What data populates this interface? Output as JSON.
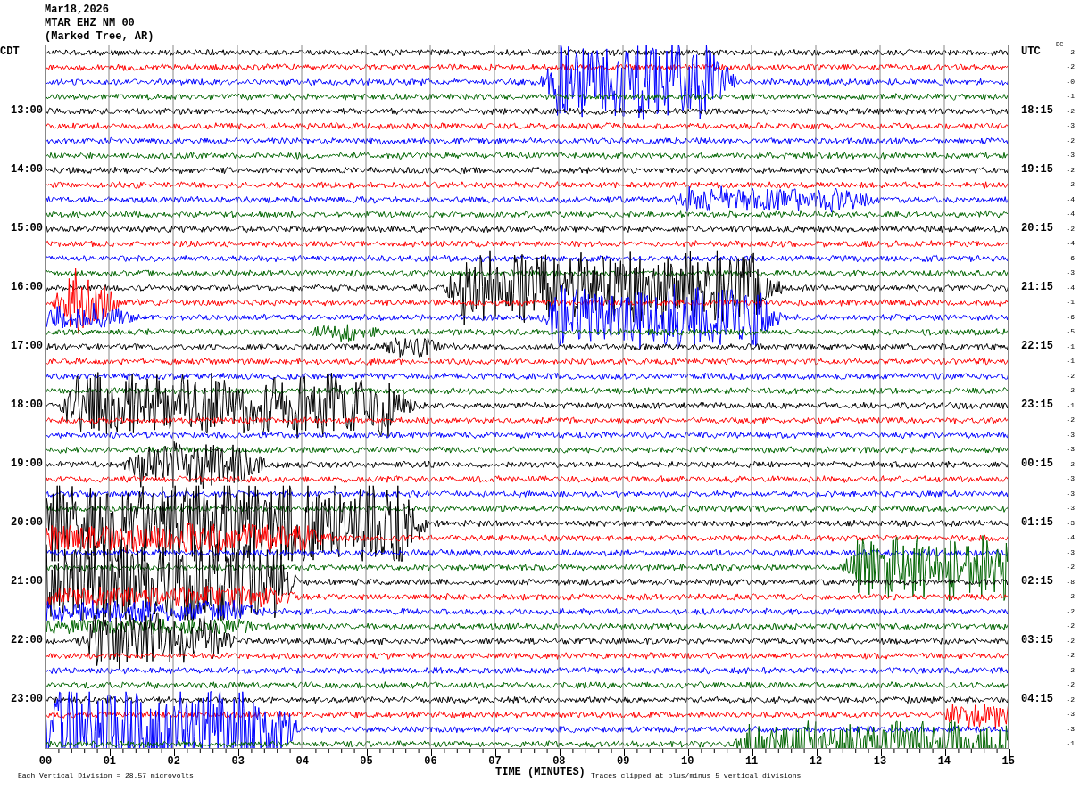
{
  "header": {
    "date": "Mar18,2026",
    "station": "MTAR EHZ NM 00",
    "location": "(Marked Tree, AR)"
  },
  "left_axis": {
    "title": "CDT",
    "hours": [
      "13:00",
      "14:00",
      "15:00",
      "16:00",
      "17:00",
      "18:00",
      "19:00",
      "20:00",
      "21:00",
      "22:00",
      "23:00"
    ]
  },
  "right_axis": {
    "title": "UTC",
    "hours": [
      "18:15",
      "19:15",
      "20:15",
      "21:15",
      "22:15",
      "23:15",
      "00:15",
      "01:15",
      "02:15",
      "03:15",
      "04:15"
    ]
  },
  "dc": {
    "label": "DC",
    "values": [
      "-2",
      "-2",
      "-0",
      "-1",
      "-2",
      "-3",
      "-2",
      "-3",
      "-2",
      "-2",
      "-4",
      "-4",
      "-2",
      "-4",
      "-6",
      "-3",
      "-4",
      "-1",
      "-6",
      "-5",
      "-1",
      "-1",
      "-2",
      "-2",
      "-1",
      "-2",
      "-3",
      "-3",
      "-2",
      "-3",
      "-3",
      "-3",
      "-3",
      "-4",
      "-3",
      "-2",
      "-8",
      "-2",
      "-2",
      "-2",
      "-2",
      "-2",
      "-2",
      "-2",
      "-2",
      "-3",
      "-3",
      "-1"
    ]
  },
  "time_axis": {
    "ticks": [
      "00",
      "01",
      "02",
      "03",
      "04",
      "05",
      "06",
      "07",
      "08",
      "09",
      "10",
      "11",
      "12",
      "13",
      "14",
      "15"
    ],
    "title": "TIME (MINUTES)"
  },
  "footer": {
    "scale_note": "Each Vertical Division = 28.57 microvolts",
    "clip_note": "Traces clipped at plus/minus 5 vertical divisions"
  }
}
